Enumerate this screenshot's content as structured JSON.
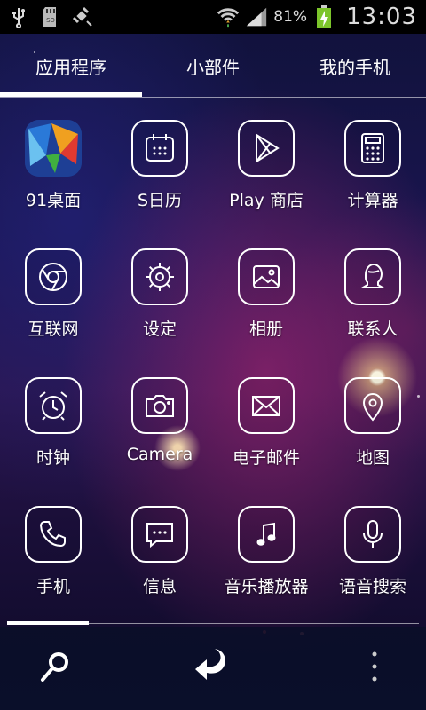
{
  "status": {
    "battery_percent": "81%",
    "time": "13:03",
    "icons": [
      "usb-icon",
      "sd-card-icon",
      "satellite-icon",
      "wifi-icon",
      "signal-icon",
      "battery-charging-icon"
    ]
  },
  "tabs": [
    {
      "label": "应用程序",
      "selected": true
    },
    {
      "label": "小部件",
      "selected": false
    },
    {
      "label": "我的手机",
      "selected": false
    }
  ],
  "apps": [
    {
      "label": "91桌面",
      "icon": "91-launcher-logo"
    },
    {
      "label": "S日历",
      "icon": "calendar-icon"
    },
    {
      "label": "Play 商店",
      "icon": "play-store-icon"
    },
    {
      "label": "计算器",
      "icon": "calculator-icon"
    },
    {
      "label": "互联网",
      "icon": "browser-icon"
    },
    {
      "label": "设定",
      "icon": "settings-gear-icon"
    },
    {
      "label": "相册",
      "icon": "gallery-icon"
    },
    {
      "label": "联系人",
      "icon": "contacts-icon"
    },
    {
      "label": "时钟",
      "icon": "alarm-clock-icon"
    },
    {
      "label": "Camera",
      "icon": "camera-icon"
    },
    {
      "label": "电子邮件",
      "icon": "email-icon"
    },
    {
      "label": "地图",
      "icon": "map-pin-icon"
    },
    {
      "label": "手机",
      "icon": "phone-icon"
    },
    {
      "label": "信息",
      "icon": "message-icon"
    },
    {
      "label": "音乐播放器",
      "icon": "music-note-icon"
    },
    {
      "label": "语音搜索",
      "icon": "microphone-icon"
    }
  ],
  "bottom_bar": {
    "buttons": [
      "search-icon",
      "back-arrow-icon",
      "overflow-menu-icon"
    ]
  }
}
